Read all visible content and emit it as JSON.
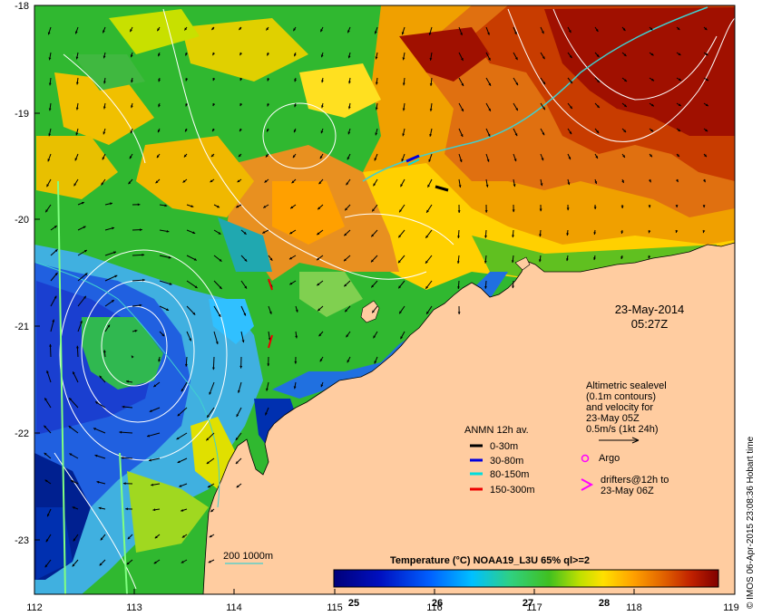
{
  "map": {
    "x_ticks": [
      "112",
      "113",
      "114",
      "115",
      "116",
      "117",
      "118",
      "119"
    ],
    "y_ticks": [
      "-18",
      "-19",
      "-20",
      "-21",
      "-22",
      "-23"
    ]
  },
  "date": {
    "line1": "23-May-2014",
    "line2": "05:27Z"
  },
  "info": {
    "line1": "Altimetric sealevel",
    "line2": "(0.1m contours)",
    "line3": "and velocity for",
    "line4": "23-May 05Z",
    "line5": "0.5m/s (1kt 24h)"
  },
  "legend": {
    "title": "ANMN 12h av.",
    "items": [
      {
        "label": "0-30m",
        "color": "#000000"
      },
      {
        "label": "30-80m",
        "color": "#0000dd"
      },
      {
        "label": "80-150m",
        "color": "#00dddd"
      },
      {
        "label": "150-300m",
        "color": "#ee0000"
      }
    ],
    "argo": "Argo",
    "drifters_line1": "drifters@12h to",
    "drifters_line2": "23-May 06Z",
    "argo_color": "#ff00ff",
    "drifter_color": "#ff00ff"
  },
  "depth_key": "200  1000m",
  "colorbar": {
    "title": "Temperature (°C) NOAA19_L3U 65% ql>=2",
    "ticks": [
      "25",
      "26",
      "27",
      "28"
    ]
  },
  "credit": "© IMOS 06-Apr-2015 23:08:36 Hobart time",
  "colors": {
    "land": "#ffcca0",
    "arrow": "#000000",
    "contour": "#ffffff",
    "shelf": "#40d0d0"
  }
}
